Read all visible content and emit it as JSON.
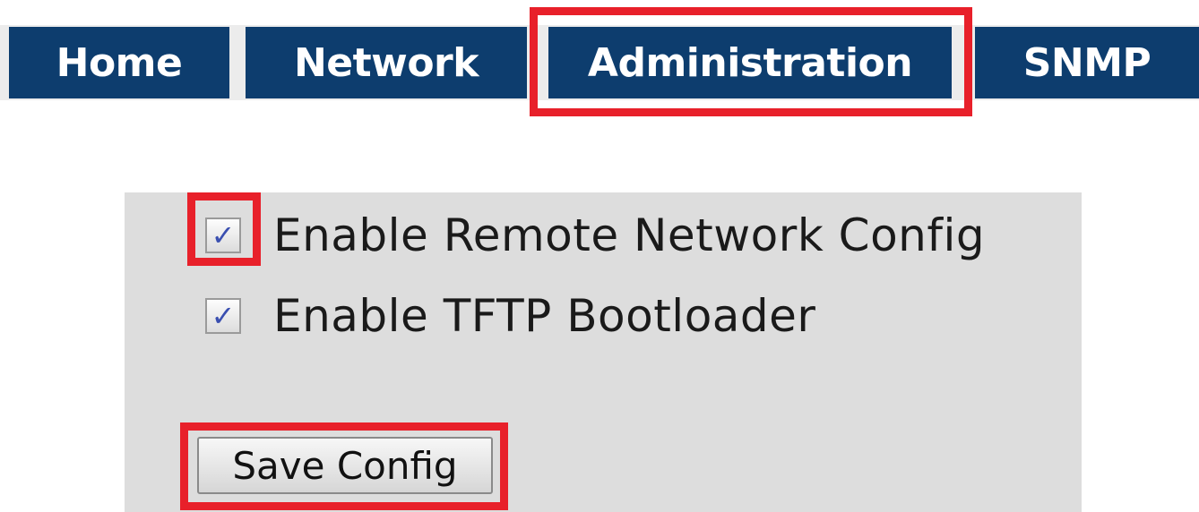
{
  "nav": {
    "tabs": [
      {
        "label": "Home"
      },
      {
        "label": "Network"
      },
      {
        "label": "Administration"
      },
      {
        "label": "SNMP"
      }
    ],
    "active_tab": "Administration"
  },
  "options": {
    "remote_network_config": {
      "label": "Enable Remote Network Config",
      "checked": true,
      "checkmark": "✓"
    },
    "tftp_bootloader": {
      "label": "Enable TFTP Bootloader",
      "checked": true,
      "checkmark": "✓"
    }
  },
  "actions": {
    "save_label": "Save Config"
  },
  "colors": {
    "tab_background": "#0d3d6e",
    "tab_text": "#ffffff",
    "panel_background": "#dddddd",
    "highlight": "#e8202a",
    "checkmark": "#3a4fb0"
  }
}
